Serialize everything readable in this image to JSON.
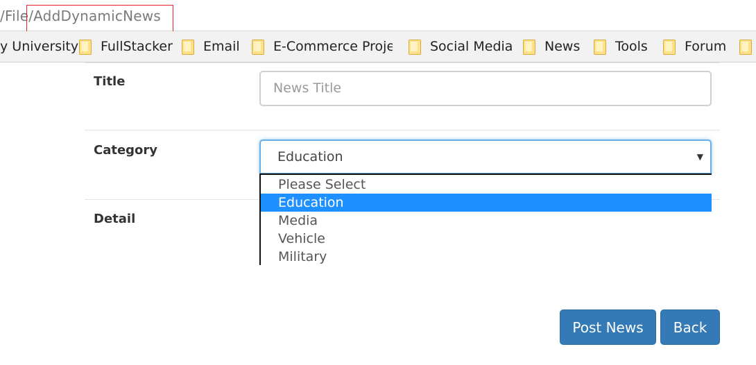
{
  "address_bar": {
    "url_text": "/File/AddDynamicNews"
  },
  "bookmarks": {
    "items": [
      {
        "label": "y University",
        "icon": "folder-icon"
      },
      {
        "label": "FullStacker",
        "icon": "folder-icon"
      },
      {
        "label": "Email",
        "icon": "folder-icon"
      },
      {
        "label": "E-Commerce Projec",
        "icon": "folder-icon"
      },
      {
        "label": "Social Media",
        "icon": "folder-icon"
      },
      {
        "label": "News",
        "icon": "folder-icon"
      },
      {
        "label": "Tools",
        "icon": "folder-icon"
      },
      {
        "label": "Forum",
        "icon": "folder-icon"
      }
    ]
  },
  "form": {
    "title_label": "Title",
    "title_placeholder": "News Title",
    "category_label": "Category",
    "category_selected": "Education",
    "category_options": [
      "Please Select",
      "Education",
      "Media",
      "Vehicle",
      "Military"
    ],
    "detail_label": "Detail"
  },
  "buttons": {
    "post_label": "Post News",
    "back_label": "Back"
  },
  "colors": {
    "primary": "#337ab7",
    "selected_option": "#1e90ff",
    "highlight_box": "#e0242b",
    "focus_border": "#66afe9"
  }
}
